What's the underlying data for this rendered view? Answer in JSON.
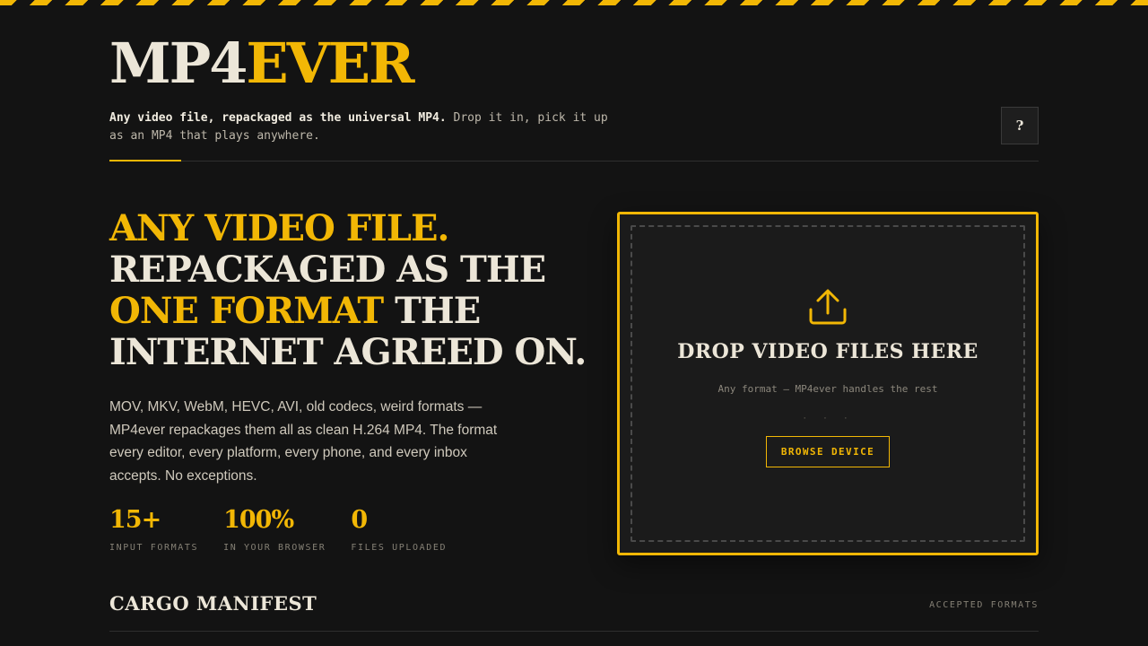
{
  "header": {
    "logo_part1": "MP4",
    "logo_part2": "EVER",
    "tagline_strong": "Any video file, repackaged as the universal MP4.",
    "tagline_rest": " Drop it in, pick it up as an MP4 that plays anywhere.",
    "help_label": "?"
  },
  "hero": {
    "line1": "ANY VIDEO FILE.",
    "line2": "REPACKAGED AS THE",
    "line3_accent": "ONE FORMAT",
    "line3_rest": " THE",
    "line4": "INTERNET AGREED ON.",
    "description": "MOV, MKV, WebM, HEVC, AVI, old codecs, weird formats — MP4ever repackages them all as clean H.264 MP4. The format every editor, every platform, every phone, and every inbox accepts. No exceptions.",
    "stats": [
      {
        "value": "15+",
        "label": "INPUT FORMATS"
      },
      {
        "value": "100%",
        "label": "IN YOUR BROWSER"
      },
      {
        "value": "0",
        "label": "FILES UPLOADED"
      }
    ]
  },
  "dropzone": {
    "icon": "upload-icon",
    "title": "DROP VIDEO FILES HERE",
    "subtitle": "Any format — MP4ever handles the rest",
    "dots": "· · ·",
    "browse_label": "BROWSE DEVICE"
  },
  "manifest": {
    "title": "CARGO MANIFEST",
    "label": "ACCEPTED FORMATS"
  },
  "colors": {
    "accent": "#f2b705",
    "background": "#131313",
    "text": "#ece6d8"
  }
}
